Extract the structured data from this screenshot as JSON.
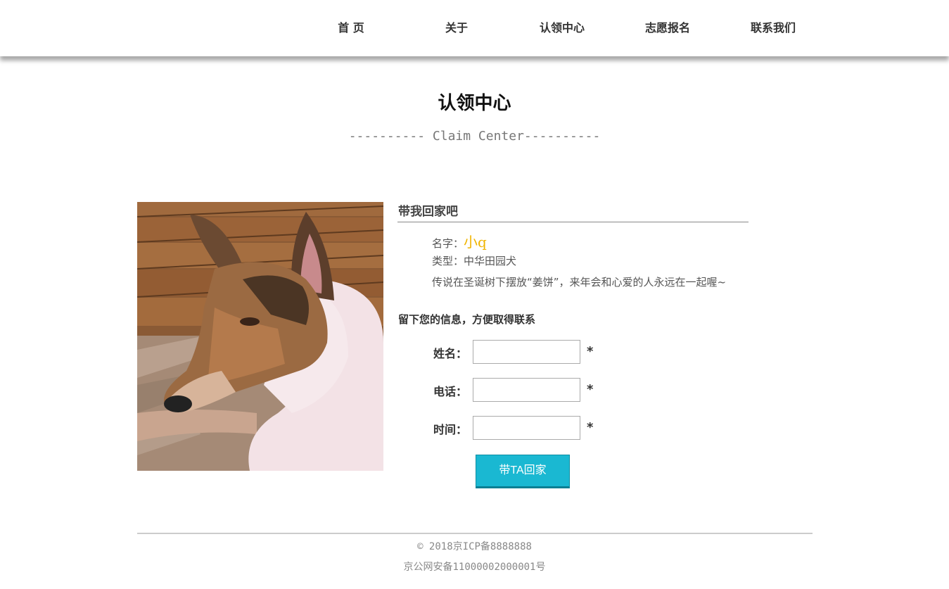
{
  "nav": {
    "items": [
      "首 页",
      "关于",
      "认领中心",
      "志愿报名",
      "联系我们"
    ]
  },
  "page": {
    "title": "认领中心",
    "subtitle": "---------- Claim Center----------"
  },
  "pet": {
    "section_title": "带我回家吧",
    "name_label": "名字：",
    "name": "小q",
    "type_label": "类型：",
    "type": "中华田园犬",
    "description": "传说在圣诞树下摆放“姜饼”，来年会和心爱的人永远在一起喔~"
  },
  "form": {
    "heading": "留下您的信息，方便取得联系",
    "name_label": "姓名：",
    "phone_label": "电话：",
    "time_label": "时间：",
    "required_mark": "*",
    "name_value": "",
    "phone_value": "",
    "time_value": "",
    "submit_label": "带TA回家"
  },
  "footer": {
    "copyright": "© 2018京ICP备8888888",
    "police": "京公网安备11000002000001号"
  }
}
